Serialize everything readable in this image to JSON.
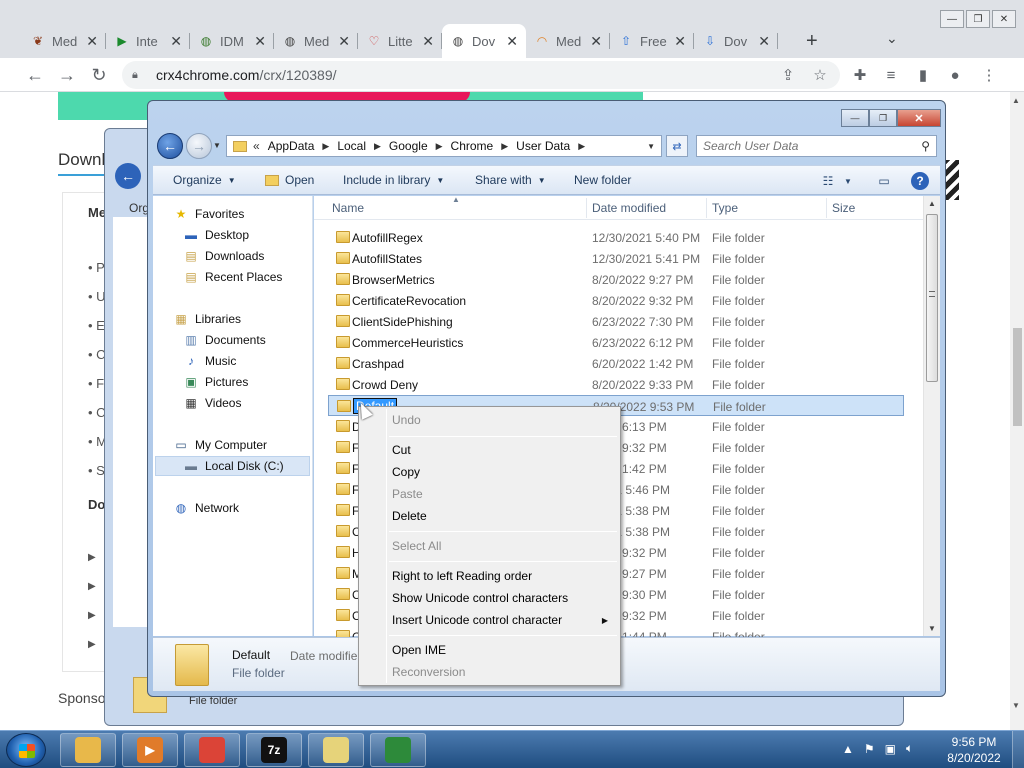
{
  "browser": {
    "tabs": [
      {
        "title": "Med",
        "icon": "paw-icon",
        "color": "#8b3a1a"
      },
      {
        "title": "Inte",
        "icon": "play-icon",
        "color": "#1b8a2d"
      },
      {
        "title": "IDM",
        "icon": "globe-icon",
        "color": "#3a7a2d"
      },
      {
        "title": "Med",
        "icon": "globe-icon",
        "color": "#444444"
      },
      {
        "title": "Litte",
        "icon": "heart-icon",
        "color": "#d04a4a"
      },
      {
        "title": "Dov",
        "icon": "globe-icon",
        "color": "#444444",
        "active": true
      },
      {
        "title": "Med",
        "icon": "rainbow-icon",
        "color": "#e0832a"
      },
      {
        "title": "Free",
        "icon": "upload-icon",
        "color": "#2a6fd6"
      },
      {
        "title": "Dov",
        "icon": "download-icon",
        "color": "#2a6fd6"
      }
    ],
    "url_host": "crx4chrome.com",
    "url_path": "/crx/120389/",
    "page": {
      "heading": "Downl",
      "side_label": "Me",
      "bullets": [
        "• P",
        "• U",
        "• E",
        "• C",
        "• F",
        "• C",
        "• M",
        "• S"
      ],
      "sub_heading": "Do",
      "arrows": [
        "▶",
        "▶",
        "▶",
        "▶"
      ],
      "sponsor": "Sponso",
      "accent": "#4dd9ad"
    }
  },
  "bg_window": {
    "org": "Orga",
    "footer_text": "File folder"
  },
  "explorer": {
    "breadcrumb": [
      "AppData",
      "Local",
      "Google",
      "Chrome",
      "User Data"
    ],
    "search_placeholder": "Search User Data",
    "commands": {
      "organize": "Organize",
      "open": "Open",
      "include": "Include in library",
      "share": "Share with",
      "new_folder": "New folder"
    },
    "nav": {
      "favorites": "Favorites",
      "desktop": "Desktop",
      "downloads": "Downloads",
      "recent": "Recent Places",
      "libraries": "Libraries",
      "documents": "Documents",
      "music": "Music",
      "pictures": "Pictures",
      "videos": "Videos",
      "computer": "My Computer",
      "local_disk": "Local Disk (C:)",
      "network": "Network"
    },
    "columns": {
      "name": "Name",
      "date": "Date modified",
      "type": "Type",
      "size": "Size"
    },
    "rows": [
      {
        "name": "AutofillRegex",
        "date": "12/30/2021 5:40 PM",
        "type": "File folder"
      },
      {
        "name": "AutofillStates",
        "date": "12/30/2021 5:41 PM",
        "type": "File folder"
      },
      {
        "name": "BrowserMetrics",
        "date": "8/20/2022 9:27 PM",
        "type": "File folder"
      },
      {
        "name": "CertificateRevocation",
        "date": "8/20/2022 9:32 PM",
        "type": "File folder"
      },
      {
        "name": "ClientSidePhishing",
        "date": "6/23/2022 7:30 PM",
        "type": "File folder"
      },
      {
        "name": "CommerceHeuristics",
        "date": "6/23/2022 6:12 PM",
        "type": "File folder"
      },
      {
        "name": "Crashpad",
        "date": "6/20/2022 1:42 PM",
        "type": "File folder"
      },
      {
        "name": "Crowd Deny",
        "date": "8/20/2022 9:33 PM",
        "type": "File folder"
      },
      {
        "name": "Default",
        "date": "8/20/2022 9:53 PM",
        "type": "File folder",
        "selected": true
      },
      {
        "name": "D",
        "date": "2022 6:13 PM",
        "type": "File folder"
      },
      {
        "name": "F",
        "date": "2022 9:32 PM",
        "type": "File folder"
      },
      {
        "name": "F",
        "date": "2022 1:42 PM",
        "type": "File folder"
      },
      {
        "name": "F",
        "date": "/2021 5:46 PM",
        "type": "File folder"
      },
      {
        "name": "F",
        "date": "/2021 5:38 PM",
        "type": "File folder"
      },
      {
        "name": "C",
        "date": "/2021 5:38 PM",
        "type": "File folder"
      },
      {
        "name": "H",
        "date": "2022 9:32 PM",
        "type": "File folder"
      },
      {
        "name": "M",
        "date": "2022 9:27 PM",
        "type": "File folder"
      },
      {
        "name": "C",
        "date": "2022 9:30 PM",
        "type": "File folder"
      },
      {
        "name": "C",
        "date": "2022 9:32 PM",
        "type": "File folder"
      },
      {
        "name": "C",
        "date": "2022 1:44 PM",
        "type": "File folder"
      }
    ],
    "details": {
      "name": "Default",
      "label": "Date modifie",
      "type": "File folder"
    }
  },
  "context_menu": {
    "undo": "Undo",
    "cut": "Cut",
    "copy": "Copy",
    "paste": "Paste",
    "delete": "Delete",
    "select_all": "Select All",
    "rtl": "Right to left Reading order",
    "show_unicode": "Show Unicode control characters",
    "insert_unicode": "Insert Unicode control character",
    "open_ime": "Open IME",
    "reconversion": "Reconversion"
  },
  "taskbar": {
    "apps": [
      {
        "name": "explorer-app",
        "icon": "folder-icon",
        "label": "",
        "color": "#e8b84a"
      },
      {
        "name": "media-player-app",
        "icon": "media-icon",
        "label": "▶",
        "color": "#e07b2a"
      },
      {
        "name": "chrome-app",
        "icon": "chrome-icon",
        "label": "",
        "color": "#db4437"
      },
      {
        "name": "7zip-app",
        "icon": "7zip-icon",
        "label": "7z",
        "color": "#111111"
      },
      {
        "name": "notepad-app",
        "icon": "notepad-icon",
        "label": "",
        "color": "#e6d37a"
      },
      {
        "name": "idm-app",
        "icon": "idm-icon",
        "label": "",
        "color": "#2d8a3a"
      }
    ],
    "time": "9:56 PM",
    "date": "8/20/2022"
  }
}
